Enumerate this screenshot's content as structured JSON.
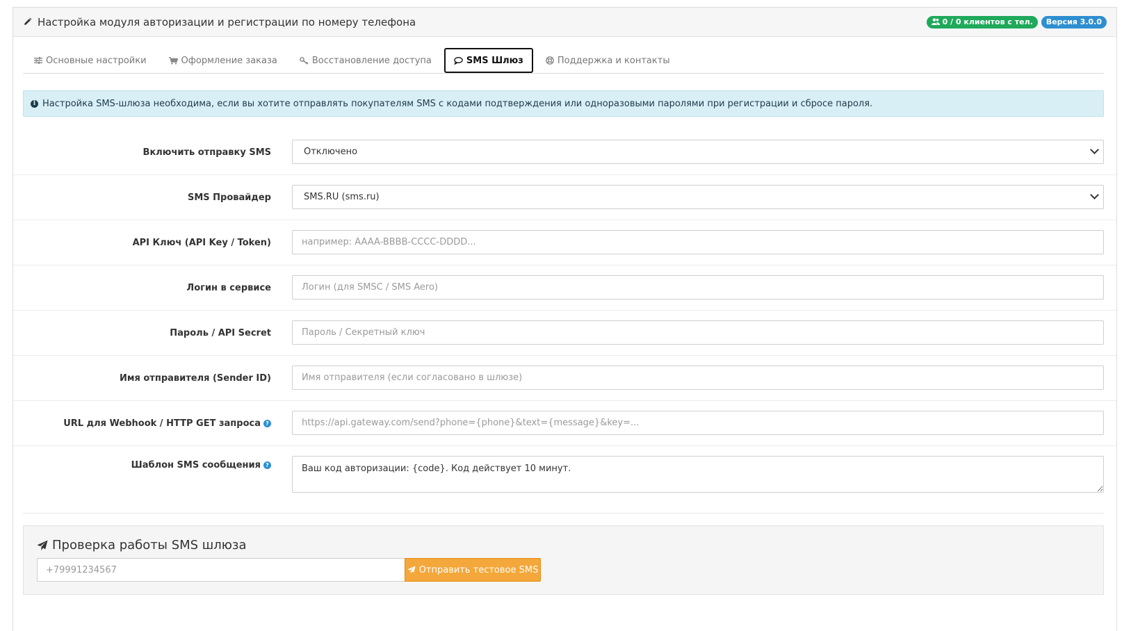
{
  "header": {
    "title": "Настройка модуля авторизации и регистрации по номеру телефона",
    "badge_clients": "0 / 0 клиентов с тел.",
    "badge_version": "Версия 3.0.0"
  },
  "tabs": [
    {
      "label": "Основные настройки",
      "icon": "sliders-icon"
    },
    {
      "label": "Оформление заказа",
      "icon": "cart-icon"
    },
    {
      "label": "Восстановление доступа",
      "icon": "key-icon"
    },
    {
      "label": "SMS Шлюз",
      "icon": "comment-icon",
      "active": true
    },
    {
      "label": "Поддержка и контакты",
      "icon": "lifebuoy-icon"
    }
  ],
  "alert": {
    "text": "Настройка SMS-шлюза необходима, если вы хотите отправлять покупателям SMS с кодами подтверждения или одноразовыми паролями при регистрации и сбросе пароля."
  },
  "form": {
    "enable_sms": {
      "label": "Включить отправку SMS",
      "value": "Отключено"
    },
    "provider": {
      "label": "SMS Провайдер",
      "value": "SMS.RU (sms.ru)"
    },
    "api_key": {
      "label": "API Ключ (API Key / Token)",
      "placeholder": "например: AAAA-BBBB-CCCC-DDDD..."
    },
    "login": {
      "label": "Логин в сервисе",
      "placeholder": "Логин (для SMSC / SMS Aero)"
    },
    "password": {
      "label": "Пароль / API Secret",
      "placeholder": "Пароль / Секретный ключ"
    },
    "sender_id": {
      "label": "Имя отправителя (Sender ID)",
      "placeholder": "Имя отправителя (если согласовано в шлюзе)"
    },
    "webhook_url": {
      "label": "URL для Webhook / HTTP GET запроса",
      "placeholder": "https://api.gateway.com/send?phone={phone}&text={message}&key=..."
    },
    "template": {
      "label": "Шаблон SMS сообщения",
      "value": "Ваш код авторизации: {code}. Код действует 10 минут."
    }
  },
  "test": {
    "title": "Проверка работы SMS шлюза",
    "phone_placeholder": "+79991234567",
    "button_label": "Отправить тестовое SMS"
  },
  "colors": {
    "badge_green": "#1fa95b",
    "badge_blue": "#2d8fd1",
    "alert_bg": "#d9eff6",
    "button_orange": "#f4a73a"
  }
}
